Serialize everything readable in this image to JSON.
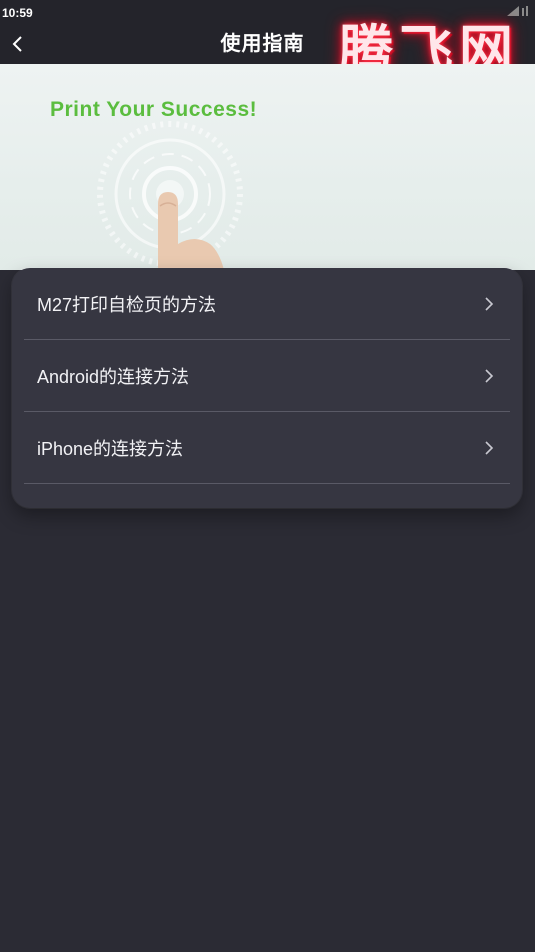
{
  "status_bar": {
    "time": "10:59"
  },
  "header": {
    "title": "使用指南",
    "back_icon": "chevron-left-icon"
  },
  "watermark": {
    "text": "腾飞网"
  },
  "banner": {
    "slogan": "Print Your Success!",
    "slogan_color": "#5bbd3f"
  },
  "menu": {
    "items": [
      {
        "label": "M27打印自检页的方法",
        "icon": "chevron-right-icon"
      },
      {
        "label": "Android的连接方法",
        "icon": "chevron-right-icon"
      },
      {
        "label": "iPhone的连接方法",
        "icon": "chevron-right-icon"
      }
    ]
  },
  "colors": {
    "background": "#2b2b34",
    "card": "#363641",
    "text": "#f2f2f5"
  }
}
